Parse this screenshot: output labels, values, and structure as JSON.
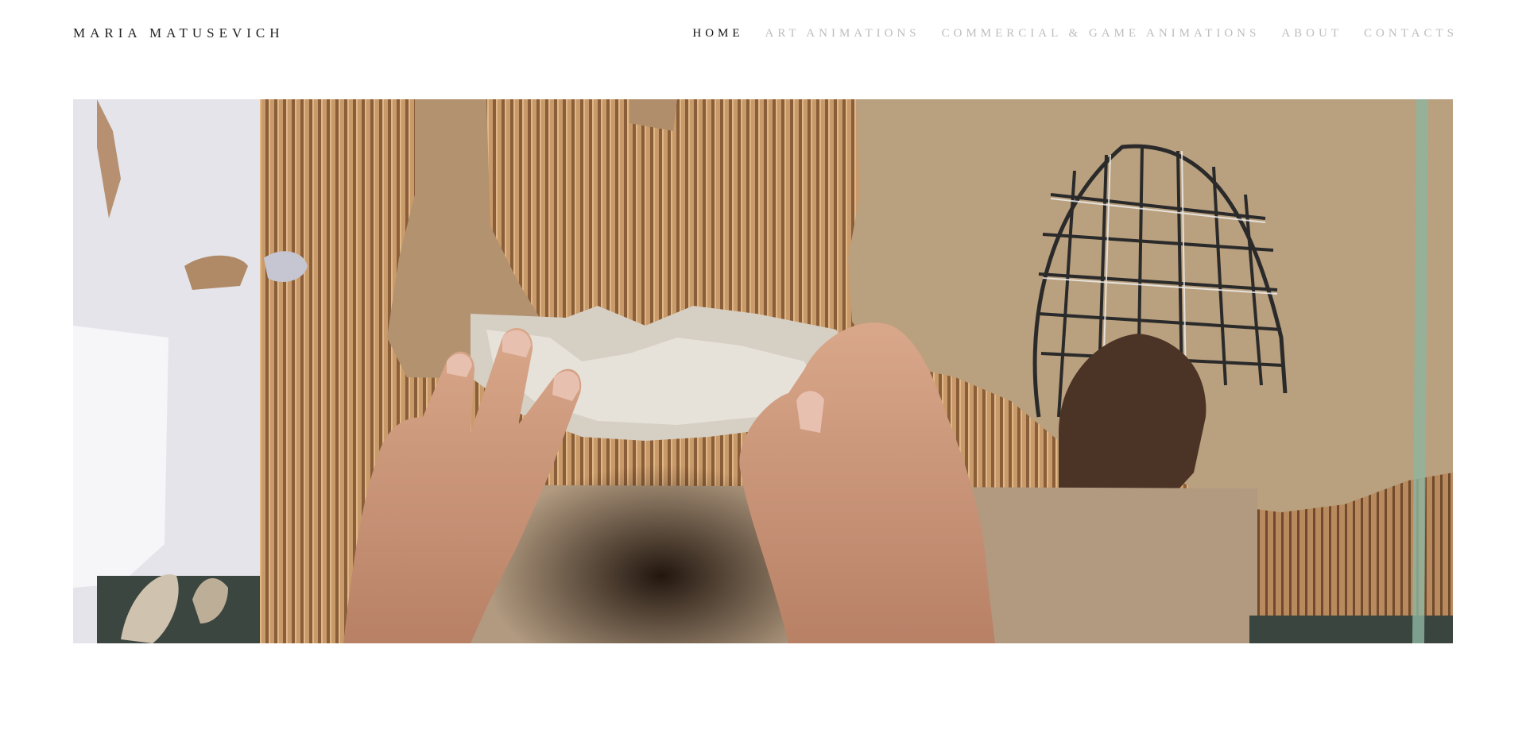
{
  "site": {
    "title": "MARIA MATUSEVICH"
  },
  "nav": {
    "items": [
      {
        "label": "HOME",
        "active": true
      },
      {
        "label": "ART ANIMATIONS",
        "active": false
      },
      {
        "label": "COMMERCIAL & GAME ANIMATIONS",
        "active": false
      },
      {
        "label": "ABOUT",
        "active": false
      },
      {
        "label": "CONTACTS",
        "active": false
      }
    ]
  },
  "hero": {
    "description": "",
    "icon": "hero-video-still"
  },
  "colors": {
    "nav_active": "#111111",
    "nav_inactive": "#bdbdbd",
    "title": "#222222",
    "background": "#ffffff"
  }
}
